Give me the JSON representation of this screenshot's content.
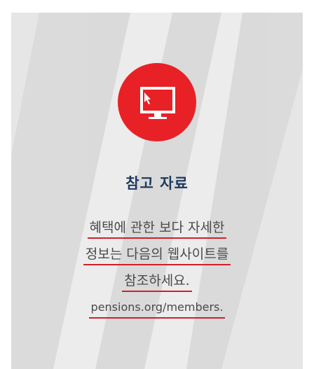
{
  "card": {
    "title": "참고 자료",
    "body_lines": [
      "혜택에 관한 보다 자세한",
      "정보는 다음의 웹사이트를",
      "참조하세요."
    ],
    "link_text": "pensions.org/members.",
    "accent_color": "#e82127",
    "title_color": "#1f3a5f",
    "icon": "computer-monitor-icon"
  }
}
